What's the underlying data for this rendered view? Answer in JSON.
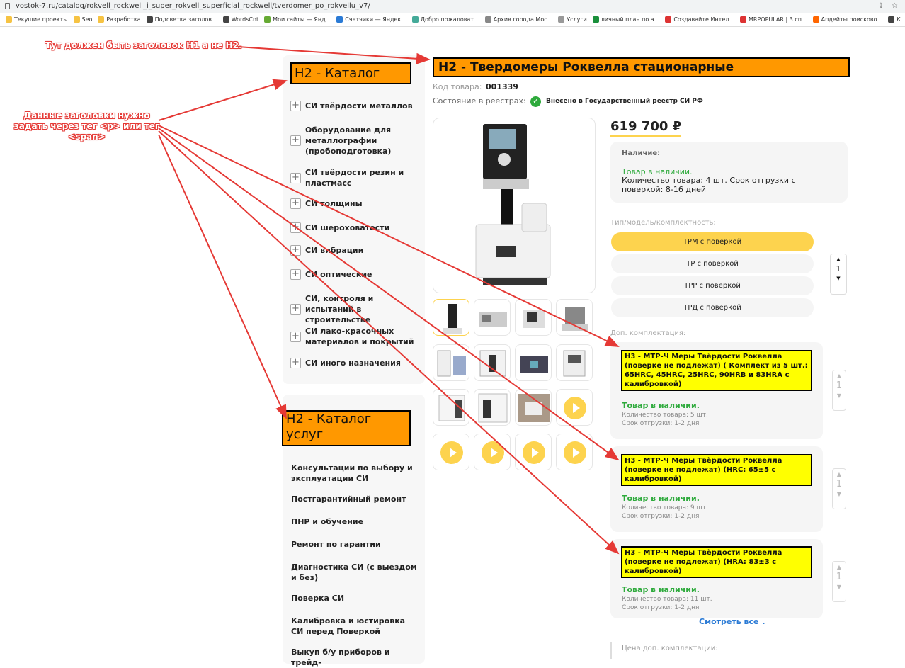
{
  "browser": {
    "url": "vostok-7.ru/catalog/rokvell_rockwell_i_super_rokvell_superficial_rockwell/tverdomer_po_rokvellu_v7/",
    "bookmarks": [
      "Текущие проекты",
      "Seo",
      "Разработка",
      "Подсветка заголов...",
      "WordsCnt",
      "Мои сайты — Янд...",
      "Счетчики — Яндек...",
      "Добро пожаловат...",
      "Архив города Мос...",
      "Услуги",
      "личный план по а...",
      "Создавайте Интел...",
      "MRPOPULAR | 3 сп...",
      "Апдейты поисково...",
      "К"
    ]
  },
  "annotations": {
    "h1_note": "Тут должен быть заголовок H1 а не H2.",
    "tags_note": "Данные заголовки нужно задать через тег <p> или тег <span>"
  },
  "product": {
    "title": "H2 - Твердомеры Роквелла стационарные",
    "code_label": "Код товара:",
    "code": "001339",
    "registry_label": "Состояние в реестрах:",
    "registry_value": "Внесено в Государственный реестр СИ РФ",
    "price": "619 700 ₽",
    "availability_label": "Наличие:",
    "in_stock": "Товар в наличии.",
    "stock_detail": "Количество товара: 4 шт. Срок отгрузки с поверкой: 8-16 дней",
    "type_label": "Тип/модель/комплектность:",
    "options": [
      "ТРМ с поверкой",
      "ТР с поверкой",
      "ТРР с поверкой",
      "ТРД с поверкой"
    ],
    "qty": "1",
    "accessories_label": "Доп. комплектация:",
    "accessories": [
      {
        "title": "H3 - МТР-Ч Меры Твёрдости Роквелла (поверке не подлежат) ( Комплект из 5 шт.: 65HRC, 45HRC, 25HRC, 90HRB и 83HRA с калибровкой)",
        "stock": "Товар в наличии.",
        "qty": "Количество товара: 5 шт.",
        "ship": "Срок отгрузки: 1-2 дня",
        "count": "1"
      },
      {
        "title": "H3 - МТР-Ч Меры Твёрдости Роквелла (поверке не подлежат) (HRC: 65±5 с калибровкой)",
        "stock": "Товар в наличии.",
        "qty": "Количество товара: 9 шт.",
        "ship": "Срок отгрузки: 1-2 дня",
        "count": "1"
      },
      {
        "title": "H3 - МТР-Ч Меры Твёрдости Роквелла (поверке не подлежат) (HRA: 83±3 с калибровкой)",
        "stock": "Товар в наличии.",
        "qty": "Количество товара: 11 шт.",
        "ship": "Срок отгрузки: 1-2 дня",
        "count": "1"
      }
    ],
    "see_all": "Смотреть все",
    "acc_price_label": "Цена доп. комплектации:"
  },
  "catalog": {
    "title": "H2 - Каталог",
    "items": [
      "СИ твёрдости металлов",
      "Оборудование для металлографии (пробоподготовка)",
      "СИ твёрдости резин и пластмасс",
      "СИ толщины",
      "СИ шероховатости",
      "СИ вибрации",
      "СИ оптические",
      "СИ, контроля и испытаний в строительстве",
      "СИ лако-красочных материалов и покрытий",
      "СИ иного назначения"
    ]
  },
  "services": {
    "title": "H2 - Каталог услуг",
    "items": [
      "Консультации по выбору и эксплуатации СИ",
      "Постгарантийный ремонт",
      "ПНР и обучение",
      "Ремонт по гарантии",
      "Диагностика СИ (с выездом и без)",
      "Поверка СИ",
      "Калибровка и юстировка СИ перед Поверкой",
      "Выкуп б/у приборов и трейд-"
    ]
  }
}
